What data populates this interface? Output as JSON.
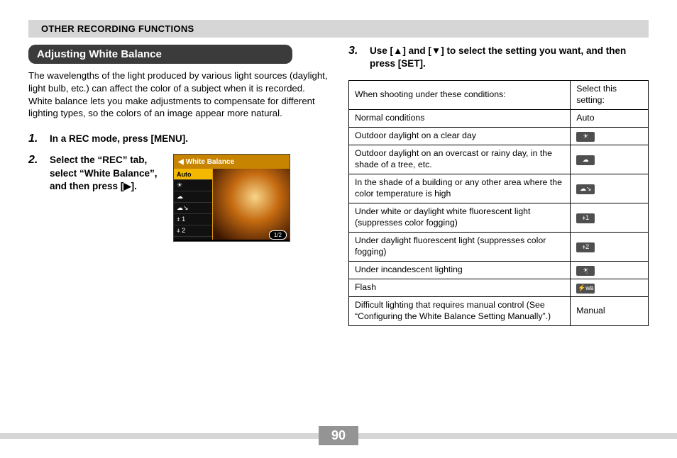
{
  "header": "OTHER RECORDING FUNCTIONS",
  "sectionTitle": "Adjusting White Balance",
  "intro": "The wavelengths of the light produced by various light sources (daylight, light bulb, etc.) can affect the color of a subject when it is recorded. White balance lets you make adjustments to compensate for different lighting types, so the colors of an image appear more natural.",
  "steps": {
    "s1": {
      "num": "1.",
      "text": "In a REC mode, press [MENU]."
    },
    "s2": {
      "num": "2.",
      "text": "Select the “REC” tab, select “White Balance”, and then press [▶]."
    },
    "s3": {
      "num": "3.",
      "text": "Use [▲] and [▼] to select the setting you want, and then press [SET]."
    }
  },
  "screenshot": {
    "title": "White Balance",
    "menu": [
      "Auto",
      "☀",
      "☁",
      "☁↘",
      "⧧ 1",
      "⧧ 2"
    ],
    "count": "1/2"
  },
  "table": {
    "head": {
      "c1": "When shooting under these conditions:",
      "c2": "Select this setting:"
    },
    "rows": [
      {
        "cond": "Normal conditions",
        "val": "Auto",
        "isText": true
      },
      {
        "cond": "Outdoor daylight on a clear day",
        "val": "☀",
        "isText": false
      },
      {
        "cond": "Outdoor daylight on an overcast or rainy day, in the shade of a tree, etc.",
        "val": "☁",
        "isText": false
      },
      {
        "cond": "In the shade of a building or any other area where the color temperature is high",
        "val": "☁↘",
        "isText": false
      },
      {
        "cond": "Under white or daylight white fluorescent light (suppresses color fogging)",
        "val": "⧧1",
        "isText": false
      },
      {
        "cond": "Under daylight fluorescent light (suppresses color fogging)",
        "val": "⧧2",
        "isText": false
      },
      {
        "cond": "Under incandescent lighting",
        "val": "☀̣",
        "isText": false
      },
      {
        "cond": "Flash",
        "val": "⚡ᴡʙ",
        "isText": false
      },
      {
        "cond": "Difficult lighting that requires manual control (See “Configuring the White Balance Setting Manually”.)",
        "val": "Manual",
        "isText": true
      }
    ]
  },
  "pageNumber": "90"
}
